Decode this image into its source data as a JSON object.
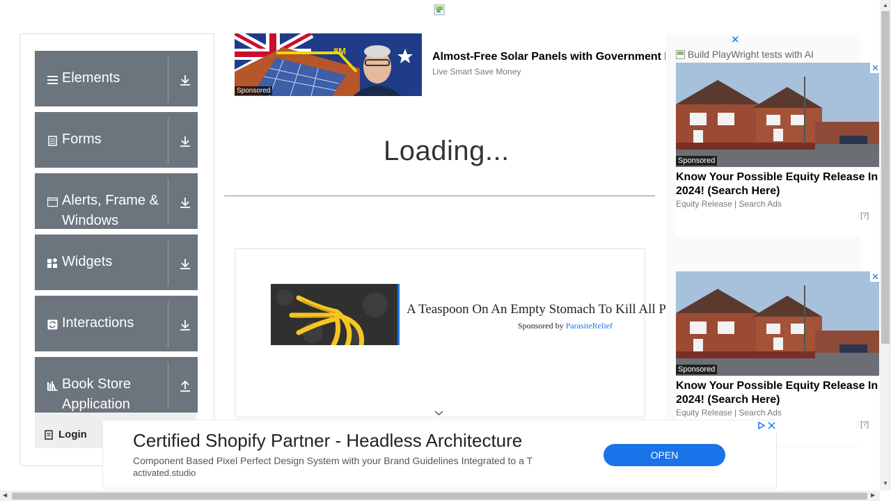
{
  "page": {
    "loading_text": "Loading..."
  },
  "sidebar": {
    "groups": [
      {
        "label": "Elements",
        "icon": "menu-icon",
        "arrow": "download-arrow-icon"
      },
      {
        "label": "Forms",
        "icon": "document-icon",
        "arrow": "download-arrow-icon"
      },
      {
        "label": "Alerts, Frame &",
        "label2": "Windows",
        "icon": "window-icon",
        "arrow": "download-arrow-icon"
      },
      {
        "label": "Widgets",
        "icon": "widgets-icon",
        "arrow": "download-arrow-icon"
      },
      {
        "label": "Interactions",
        "icon": "interactions-icon",
        "arrow": "download-arrow-icon"
      },
      {
        "label": "Book Store",
        "label2": "Application",
        "icon": "books-icon",
        "arrow": "upload-arrow-icon"
      }
    ],
    "login_item": {
      "label": "Login",
      "icon": "login-icon"
    }
  },
  "ads": {
    "top_banner": {
      "title": "Almost-Free Solar Panels with Government Funding",
      "subtitle": "Live Smart Save Money",
      "sponsored": "Sponsored",
      "image_text": "8M"
    },
    "middle": {
      "title": "A Teaspoon On An Empty Stomach To Kill All P",
      "sponsored_by": "Sponsored by",
      "sponsor": "ParasiteRelief"
    },
    "right": {
      "close": "✕",
      "alt_text": "Build PlayWright tests with AI",
      "cards": [
        {
          "sponsored": "Sponsored",
          "title": "Know Your Possible Equity Release In 2024! (Search Here)",
          "source": "Equity Release | Search Ads",
          "help": "[?]"
        },
        {
          "sponsored": "Sponsored",
          "title": "Know Your Possible Equity Release In 2024! (Search Here)",
          "source": "Equity Release | Search Ads",
          "help": "[?]"
        }
      ]
    },
    "bottom": {
      "title": "Certified Shopify Partner - Headless Architecture",
      "subtitle": "Component Based Pixel Perfect Design System with your Brand Guidelines Integrated to a T",
      "domain": "activated.studio",
      "button": "OPEN"
    }
  },
  "colors": {
    "sidebar_group_bg": "#6c757d",
    "accent_blue": "#1a73e8"
  }
}
